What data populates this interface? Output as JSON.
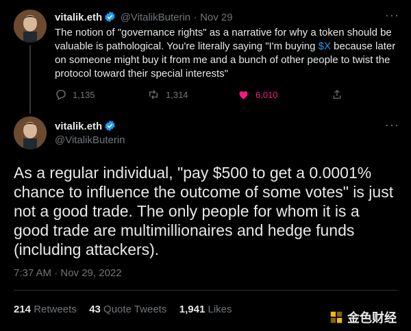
{
  "tweet1": {
    "name": "vitalik.eth",
    "handle": "@VitalikButerin",
    "separator": "·",
    "date": "Nov 29",
    "text_before": "The notion of \"governance rights\" as a narrative for why a token should be valuable is pathological. You're literally saying \"I'm buying ",
    "cashtag": "$X",
    "text_after": " because later on someone might buy it from me and a bunch of other people to twist the protocol toward their special interests\"",
    "replies": "1,135",
    "retweets": "1,314",
    "likes": "6,010"
  },
  "tweet2": {
    "name": "vitalik.eth",
    "handle": "@VitalikButerin",
    "text": "As a regular individual, \"pay $500 to get a 0.0001% chance to influence the outcome of some votes\" is just not a good trade. The only people for whom it is a good trade are multimillionaires and hedge funds (including attackers).",
    "timestamp": "7:37 AM · Nov 29, 2022",
    "retweets_count": "214",
    "retweets_label": "Retweets",
    "quotes_count": "43",
    "quotes_label": "Quote Tweets",
    "likes_count": "1,941",
    "likes_label": "Likes"
  },
  "watermark": {
    "text": "金色财经"
  },
  "colors": {
    "accent": "#1d9bf0",
    "like": "#f91880",
    "muted": "#71767b"
  }
}
